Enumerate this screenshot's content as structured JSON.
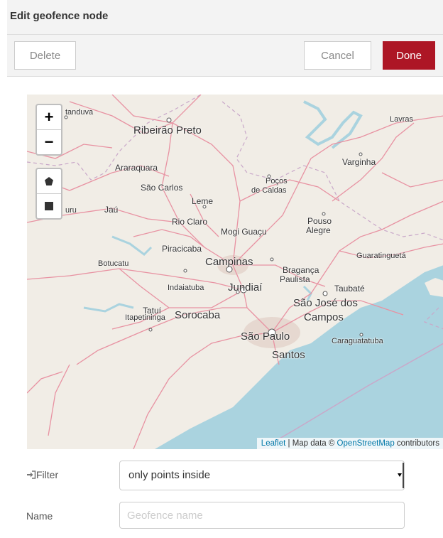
{
  "dialog": {
    "title": "Edit geofence node",
    "delete_label": "Delete",
    "cancel_label": "Cancel",
    "done_label": "Done",
    "done_color": "#ad1625"
  },
  "map": {
    "zoom_in": "+",
    "zoom_out": "−",
    "polygon_tool_icon": "pentagon-icon",
    "rectangle_tool_icon": "square-icon",
    "attribution": {
      "leaflet": "Leaflet",
      "separator": " | Map data © ",
      "osm": "OpenStreetMap",
      "suffix": " contributors"
    },
    "places": {
      "catanduva": "tanduva",
      "ribeirao_preto": "Ribeirão Preto",
      "lavras": "Lavras",
      "varginha": "Varginha",
      "araraquara": "Araraquara",
      "sao_carlos": "São Carlos",
      "pocos": "Poços",
      "de_caldas": "de Caldas",
      "leme": "Leme",
      "bauru": "uru",
      "jau": "Jaú",
      "rio_claro": "Rio Claro",
      "mogi_guacu": "Mogi Guaçu",
      "pouso": "Pouso",
      "alegre": "Alegre",
      "piracicaba": "Piracicaba",
      "botucatu": "Botucatu",
      "campinas": "Campinas",
      "bragança": "Bragança",
      "paulista": "Paulista",
      "guaratingueta": "Guaratinguetá",
      "indaiatuba": "Indaiatuba",
      "jundiai": "Jundiaí",
      "taubate": "Taubaté",
      "tatui": "Tatuí",
      "sorocaba": "Sorocaba",
      "sao_jose_dos": "São José dos",
      "campos": "Campos",
      "itapetininga": "Itapetininga",
      "sao_paulo": "São Paulo",
      "caraguatatuba": "Caraguatatuba",
      "santos": "Santos"
    }
  },
  "form": {
    "filter_icon": "sign-in-icon",
    "filter_label": "Filter",
    "filter_value": "only points inside",
    "name_label": "Name",
    "name_placeholder": "Geofence name",
    "name_value": ""
  }
}
